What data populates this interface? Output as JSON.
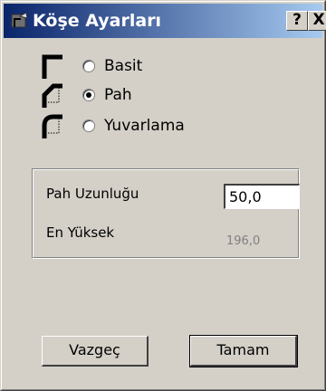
{
  "window": {
    "title": "Köşe Ayarları",
    "help_label": "?",
    "close_label": "X"
  },
  "corner_options": [
    {
      "label": "Basit",
      "selected": false,
      "icon": "square-corner-icon"
    },
    {
      "label": "Pah",
      "selected": true,
      "icon": "chamfer-corner-icon"
    },
    {
      "label": "Yuvarlama",
      "selected": false,
      "icon": "round-corner-icon"
    }
  ],
  "settings": {
    "length_label": "Pah Uzunluğu",
    "length_value": "50,0",
    "max_label": "En Yüksek",
    "max_value": "196,0"
  },
  "buttons": {
    "cancel_label": "Vazgeç",
    "ok_label": "Tamam"
  }
}
